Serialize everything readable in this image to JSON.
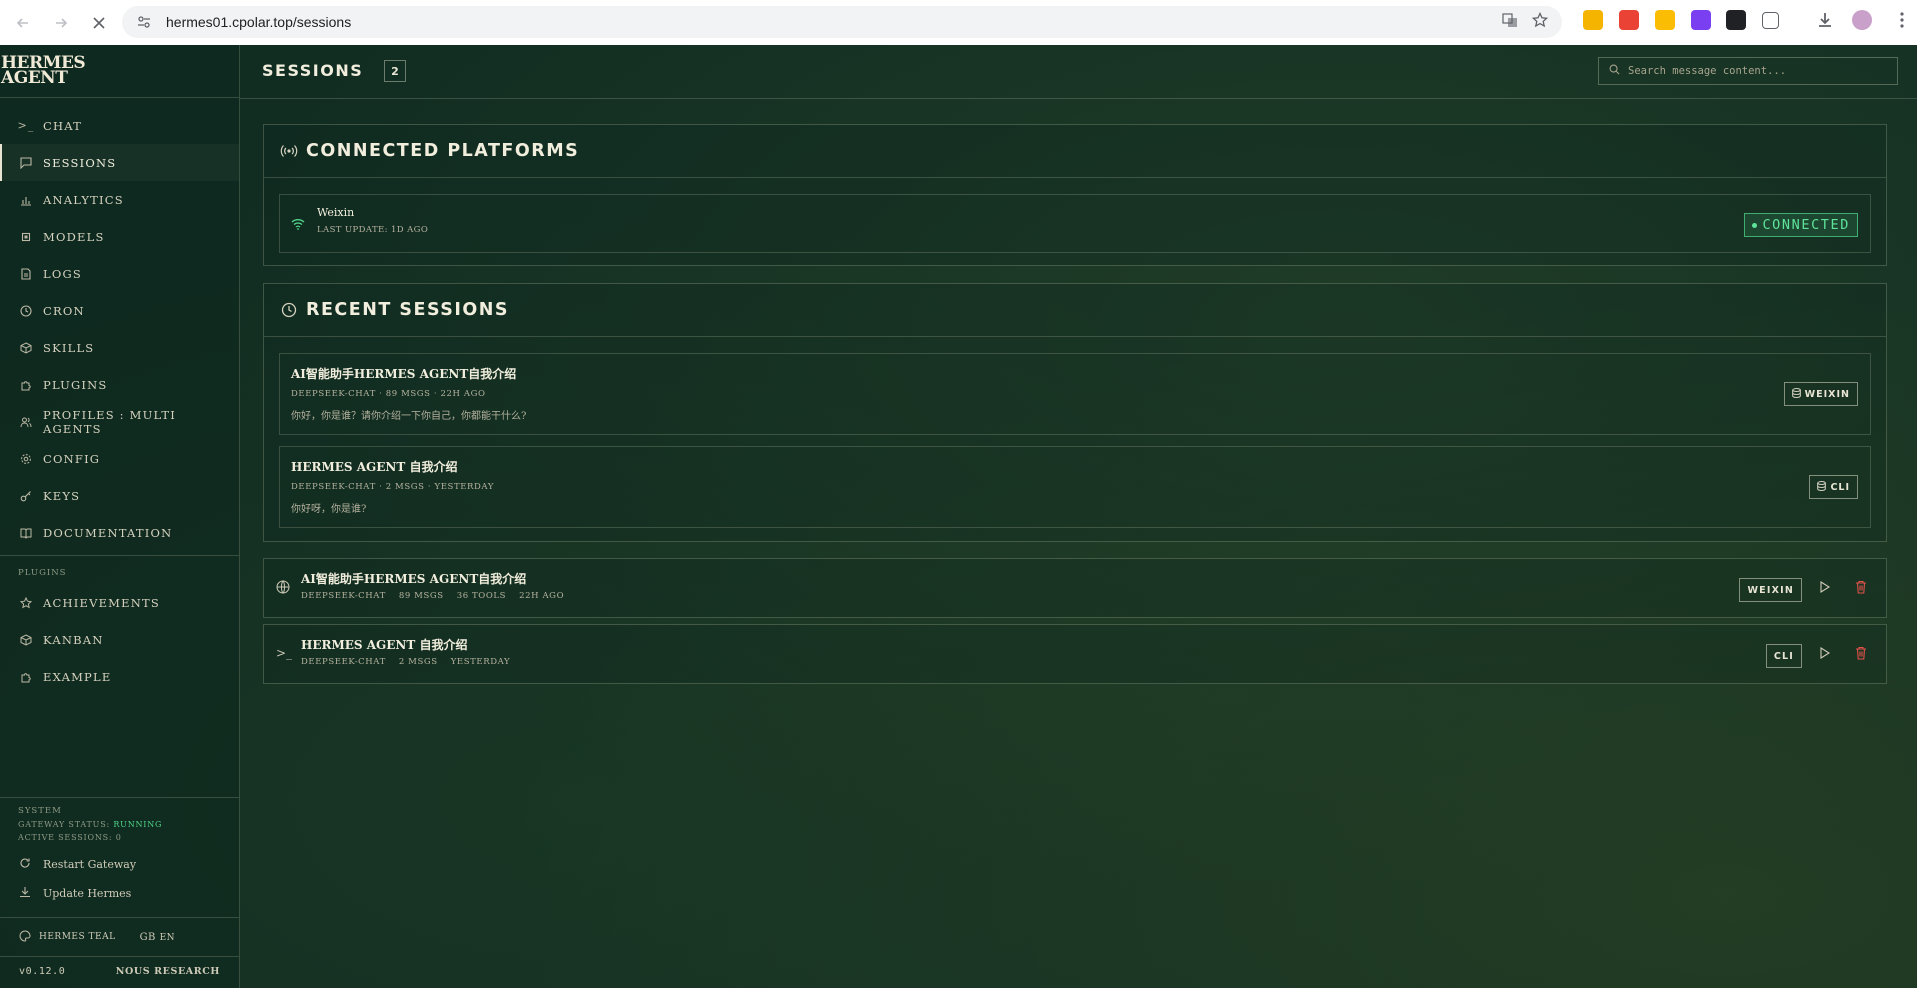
{
  "browser": {
    "url_host": "hermes01.cpolar.top",
    "url_path": "/sessions"
  },
  "sidebar": {
    "brand_line1": "HERMES",
    "brand_line2": "AGENT",
    "nav": [
      {
        "label": "CHAT",
        "icon": "terminal-icon"
      },
      {
        "label": "SESSIONS",
        "icon": "message-square-icon",
        "active": true
      },
      {
        "label": "ANALYTICS",
        "icon": "bar-chart-icon"
      },
      {
        "label": "MODELS",
        "icon": "cpu-icon"
      },
      {
        "label": "LOGS",
        "icon": "file-text-icon"
      },
      {
        "label": "CRON",
        "icon": "clock-icon"
      },
      {
        "label": "SKILLS",
        "icon": "package-icon"
      },
      {
        "label": "PLUGINS",
        "icon": "puzzle-icon"
      },
      {
        "label": "PROFILES : MULTI AGENTS",
        "icon": "users-icon"
      },
      {
        "label": "CONFIG",
        "icon": "settings-icon"
      },
      {
        "label": "KEYS",
        "icon": "key-icon"
      },
      {
        "label": "DOCUMENTATION",
        "icon": "book-icon"
      }
    ],
    "plugins_label": "PLUGINS",
    "plugins": [
      {
        "label": "ACHIEVEMENTS",
        "icon": "star-icon"
      },
      {
        "label": "KANBAN",
        "icon": "package-icon"
      },
      {
        "label": "EXAMPLE",
        "icon": "puzzle-icon"
      }
    ],
    "system": {
      "label": "SYSTEM",
      "gateway_prefix": "GATEWAY STATUS: ",
      "gateway_status": "RUNNING",
      "active_sessions": "ACTIVE SESSIONS: 0",
      "restart": "Restart Gateway",
      "update": "Update Hermes"
    },
    "theme": "HERMES TEAL",
    "lang_flag": "GB",
    "lang": "EN",
    "version": "v0.12.0",
    "org": "NOUS RESEARCH"
  },
  "header": {
    "title": "SESSIONS",
    "count": "2",
    "search_placeholder": "Search message content..."
  },
  "platforms": {
    "title": "CONNECTED PLATFORMS",
    "items": [
      {
        "name": "Weixin",
        "sub": "LAST UPDATE: 1D AGO",
        "status": "CONNECTED"
      }
    ]
  },
  "recent": {
    "title": "RECENT SESSIONS",
    "items": [
      {
        "title": "AI智能助手HERMES AGENT自我介绍",
        "meta": "DEEPSEEK-CHAT · 89 MSGS · 22H AGO",
        "preview": "你好，你是谁？请你介绍一下你自己，你都能干什么?",
        "source": "WEIXIN"
      },
      {
        "title": "HERMES AGENT 自我介绍",
        "meta": "DEEPSEEK-CHAT · 2 MSGS · YESTERDAY",
        "preview": "你好呀，你是谁?",
        "source": "CLI"
      }
    ]
  },
  "sessions": [
    {
      "title": "AI智能助手HERMES AGENT自我介绍",
      "model": "DEEPSEEK-CHAT",
      "msgs": "89 MSGS",
      "tools": "36 TOOLS",
      "time": "22H AGO",
      "source": "WEIXIN",
      "icon": "globe-icon"
    },
    {
      "title": "HERMES AGENT 自我介绍",
      "model": "DEEPSEEK-CHAT",
      "msgs": "2 MSGS",
      "time": "YESTERDAY",
      "source": "CLI",
      "icon": "terminal-icon"
    }
  ],
  "colors": {
    "background": "#112d22",
    "accent_green": "#5fe39a",
    "danger": "#e3514a"
  }
}
